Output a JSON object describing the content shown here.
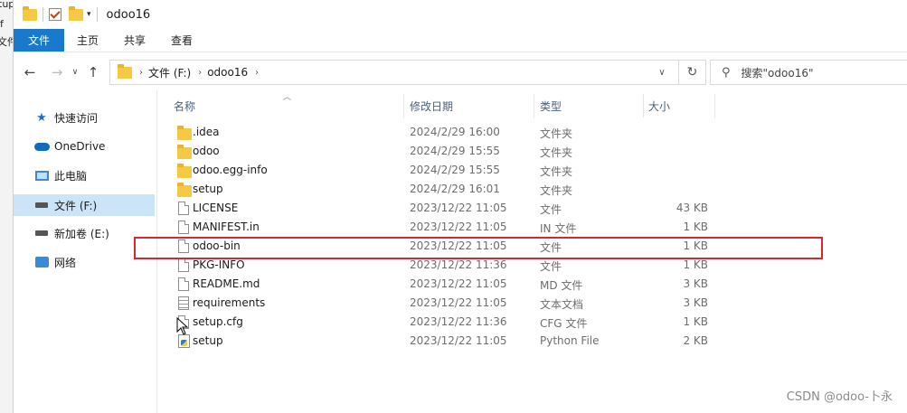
{
  "background": {
    "lines": [
      "tup",
      "f",
      "",
      "文件"
    ]
  },
  "titlebar": {
    "title": "odoo16"
  },
  "ribbon": {
    "tabs": [
      "文件",
      "主页",
      "共享",
      "查看"
    ]
  },
  "addressbar": {
    "crumbs": [
      "文件 (F:)",
      "odoo16"
    ],
    "search_placeholder": "搜索\"odoo16\""
  },
  "navpane": {
    "items": [
      {
        "label": "快速访问",
        "icon": "star-icon"
      },
      {
        "label": "OneDrive",
        "icon": "cloud-icon"
      },
      {
        "label": "此电脑",
        "icon": "pc-icon"
      },
      {
        "label": "文件 (F:)",
        "icon": "drive-icon",
        "selected": true
      },
      {
        "label": "新加卷 (E:)",
        "icon": "drive-icon"
      },
      {
        "label": "网络",
        "icon": "network-icon"
      }
    ]
  },
  "columns": {
    "name": "名称",
    "date": "修改日期",
    "type": "类型",
    "size": "大小"
  },
  "files": [
    {
      "name": ".idea",
      "date": "2024/2/29 16:00",
      "type": "文件夹",
      "size": "",
      "icon": "folder-icon"
    },
    {
      "name": "odoo",
      "date": "2024/2/29 15:55",
      "type": "文件夹",
      "size": "",
      "icon": "folder-icon"
    },
    {
      "name": "odoo.egg-info",
      "date": "2024/2/29 15:55",
      "type": "文件夹",
      "size": "",
      "icon": "folder-icon"
    },
    {
      "name": "setup",
      "date": "2024/2/29 16:01",
      "type": "文件夹",
      "size": "",
      "icon": "folder-icon"
    },
    {
      "name": "LICENSE",
      "date": "2023/12/22 11:05",
      "type": "文件",
      "size": "43 KB",
      "icon": "file-icon"
    },
    {
      "name": "MANIFEST.in",
      "date": "2023/12/22 11:05",
      "type": "IN 文件",
      "size": "1 KB",
      "icon": "file-icon"
    },
    {
      "name": "odoo-bin",
      "date": "2023/12/22 11:05",
      "type": "文件",
      "size": "1 KB",
      "icon": "file-icon"
    },
    {
      "name": "PKG-INFO",
      "date": "2023/12/22 11:36",
      "type": "文件",
      "size": "1 KB",
      "icon": "file-icon"
    },
    {
      "name": "README.md",
      "date": "2023/12/22 11:05",
      "type": "MD 文件",
      "size": "3 KB",
      "icon": "file-icon"
    },
    {
      "name": "requirements",
      "date": "2023/12/22 11:05",
      "type": "文本文档",
      "size": "3 KB",
      "icon": "text-file-icon"
    },
    {
      "name": "setup.cfg",
      "date": "2023/12/22 11:36",
      "type": "CFG 文件",
      "size": "1 KB",
      "icon": "file-icon"
    },
    {
      "name": "setup",
      "date": "2023/12/22 11:05",
      "type": "Python File",
      "size": "2 KB",
      "icon": "python-file-icon"
    }
  ],
  "watermark": "CSDN @odoo-卜永",
  "colors": {
    "accent": "#1979ca",
    "selection": "#cce4f7",
    "highlight": "#d9272e"
  }
}
